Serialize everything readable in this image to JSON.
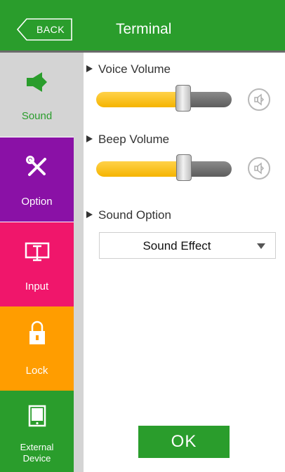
{
  "header": {
    "back_label": "BACK",
    "title": "Terminal"
  },
  "sidebar": {
    "items": [
      {
        "label": "Sound",
        "icon": "speaker-icon",
        "color": "#d4d4d4",
        "text_color": "#2a9d2c",
        "selected": true
      },
      {
        "label": "Option",
        "icon": "tools-icon",
        "color": "#8a11a6",
        "text_color": "#ffffff",
        "selected": false
      },
      {
        "label": "Input",
        "icon": "input-icon",
        "color": "#f0166b",
        "text_color": "#ffffff",
        "selected": false
      },
      {
        "label": "Lock",
        "icon": "lock-icon",
        "color": "#ff9d00",
        "text_color": "#ffffff",
        "selected": false
      },
      {
        "label": "External\nDevice",
        "icon": "device-icon",
        "color": "#2a9d2c",
        "text_color": "#ffffff",
        "selected": false
      }
    ]
  },
  "content": {
    "voice_volume": {
      "label": "Voice Volume",
      "value_fraction": 0.64
    },
    "beep_volume": {
      "label": "Beep Volume",
      "value_fraction": 0.65
    },
    "sound_option": {
      "label": "Sound Option",
      "selected": "Sound Effect"
    }
  },
  "ok_label": "OK",
  "colors": {
    "accent_green": "#2a9d2c",
    "slider_fill": "#f5b400",
    "slider_rest": "#6d6d6d"
  }
}
